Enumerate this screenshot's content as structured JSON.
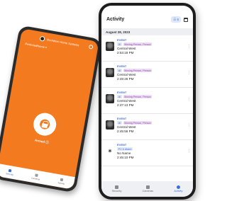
{
  "back_app": {
    "header_title": "OvrAdmin Home Systems",
    "account_label": "ProtectedHome ▾",
    "armed_label": "Armed ⓘ",
    "nav": [
      "Security",
      "Cameras",
      "Activity"
    ]
  },
  "activity": {
    "title": "Activity",
    "filter_label": "☰ 6",
    "date": "August 28, 2023",
    "rows": [
      {
        "event": "EVENT",
        "tags": [
          "AI",
          "Moving Person, Person"
        ],
        "location": "Central West",
        "time": "2:53:18 PM"
      },
      {
        "event": "EVENT",
        "tags": [
          "AI",
          "Moving Person, Person"
        ],
        "location": "Central West",
        "time": "2:49:26 PM"
      },
      {
        "event": "EVENT",
        "tags": [
          "AI",
          "Moving Person, Person"
        ],
        "location": "Central West",
        "time": "2:47:13 PM"
      },
      {
        "event": "EVENT",
        "tags": [
          "AI",
          "Moving Person, Person"
        ],
        "location": "Central West",
        "time": "2:45:56 PM"
      },
      {
        "event": "EVENT",
        "tags": [
          "P1 ↯ Alarm"
        ],
        "location": "No Name",
        "time": "2:45:10 PM"
      },
      {
        "event": "EVENT",
        "tags": [],
        "location": "",
        "time": ""
      }
    ],
    "nav": [
      "Security",
      "Cameras",
      "Activity"
    ]
  }
}
